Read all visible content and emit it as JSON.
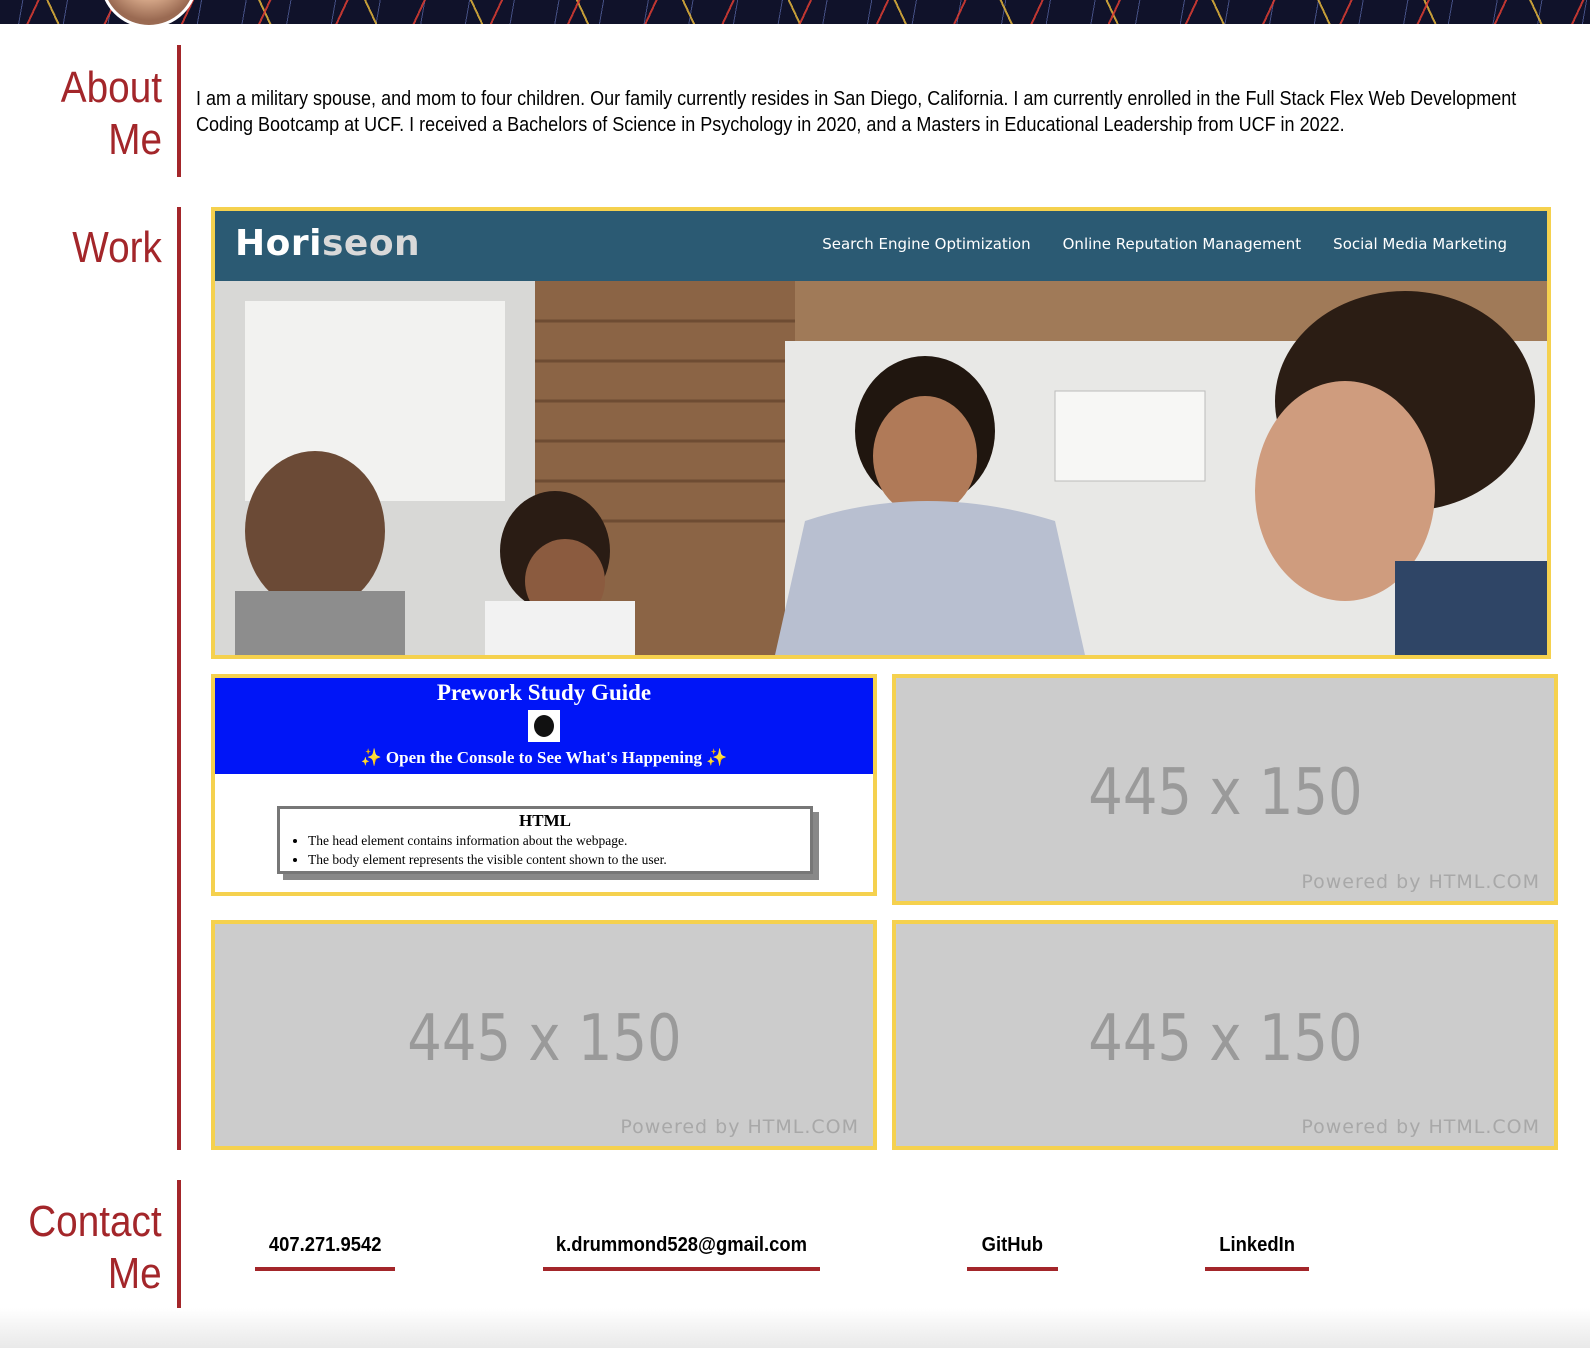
{
  "about": {
    "heading_line1": "About",
    "heading_line2": "Me",
    "text": "I am a military spouse, and mom to four children. Our family currently resides in San Diego, California. I am currently enrolled in the Full Stack Flex Web Development Coding Bootcamp at UCF. I received a Bachelors of Science in Psychology in 2020, and a Masters in Educational Leadership from UCF in 2022."
  },
  "work": {
    "heading": "Work",
    "horiseon": {
      "logo_bold": "Hori",
      "logo_light": "seon",
      "nav": [
        "Search Engine Optimization",
        "Online Reputation Management",
        "Social Media Marketing"
      ]
    },
    "prework": {
      "title": "Prework Study Guide",
      "subtitle": "✨ Open the Console to See What's Happening ✨",
      "box_title": "HTML",
      "bullets": [
        "The head element contains information about the webpage.",
        "The body element represents the visible content shown to the user."
      ]
    },
    "placeholders": [
      {
        "size": "445 x 150",
        "powered": "Powered by HTML.COM"
      },
      {
        "size": "445 x 150",
        "powered": "Powered by HTML.COM"
      },
      {
        "size": "445 x 150",
        "powered": "Powered by HTML.COM"
      }
    ]
  },
  "contact": {
    "heading_line1": "Contact",
    "heading_line2": "Me",
    "links": [
      "407.271.9542",
      "k.drummond528@gmail.com",
      "GitHub",
      "LinkedIn"
    ]
  },
  "colors": {
    "accent": "#a3262a",
    "card_border": "#f5d14e",
    "horiseon_header": "#2b5a73",
    "prework_banner": "#0015f7"
  }
}
